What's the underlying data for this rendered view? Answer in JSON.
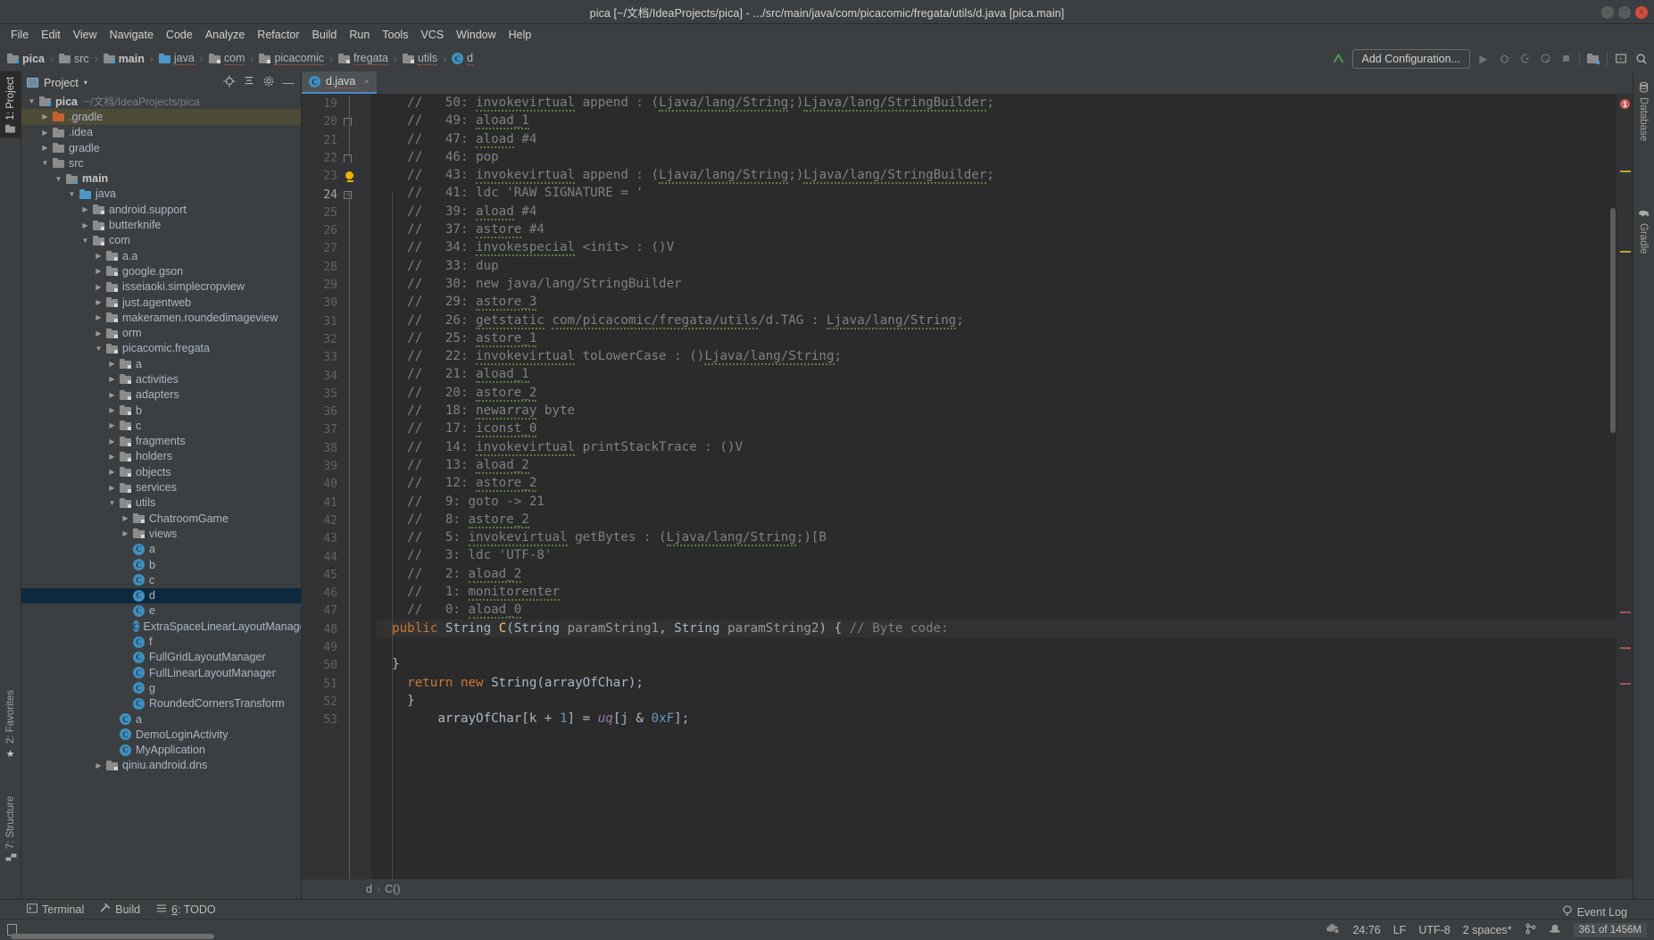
{
  "window": {
    "title": "pica [~/文档/IdeaProjects/pica] - .../src/main/java/com/picacomic/fregata/utils/d.java [pica.main]",
    "minimize": "–",
    "maximize": "□",
    "close": "×"
  },
  "menu": [
    "File",
    "Edit",
    "View",
    "Navigate",
    "Code",
    "Analyze",
    "Refactor",
    "Build",
    "Run",
    "Tools",
    "VCS",
    "Window",
    "Help"
  ],
  "breadcrumbs": [
    {
      "label": "pica",
      "icon": "source-root-folder-icon",
      "kind": "src",
      "bold": true,
      "spell": false
    },
    {
      "label": "src",
      "icon": "folder-icon",
      "kind": "grey",
      "bold": false,
      "spell": false
    },
    {
      "label": "main",
      "icon": "source-root-folder-icon",
      "kind": "src",
      "bold": true,
      "spell": false
    },
    {
      "label": "java",
      "icon": "folder-blue-icon",
      "kind": "blue",
      "bold": false,
      "spell": true
    },
    {
      "label": "com",
      "icon": "package-icon",
      "kind": "pkg",
      "bold": false,
      "spell": true
    },
    {
      "label": "picacomic",
      "icon": "package-icon",
      "kind": "pkg",
      "bold": false,
      "spell": true
    },
    {
      "label": "fregata",
      "icon": "package-icon",
      "kind": "pkg",
      "bold": false,
      "spell": true
    },
    {
      "label": "utils",
      "icon": "package-icon",
      "kind": "pkg",
      "bold": false,
      "spell": true
    },
    {
      "label": "d",
      "icon": "class-icon",
      "kind": "cls",
      "bold": false,
      "spell": true
    }
  ],
  "toolbar": {
    "add_configuration": "Add Configuration...",
    "icons": [
      "vcs-update-icon",
      "run-icon",
      "debug-icon",
      "run-coverage-icon",
      "profile-icon",
      "stop-icon",
      "project-structure-icon",
      "device-manager-icon",
      "search-everywhere-icon"
    ]
  },
  "left_tool_tabs": [
    {
      "label": "1: Project",
      "mnemonic": "1",
      "icon": "project-icon",
      "active": true
    },
    {
      "label": "2: Favorites",
      "mnemonic": "2",
      "icon": "star-icon",
      "active": false
    },
    {
      "label": "7: Structure",
      "mnemonic": "7",
      "icon": "structure-icon",
      "active": false
    }
  ],
  "right_tool_tabs": [
    {
      "label": "Database",
      "icon": "database-icon"
    },
    {
      "label": "Gradle",
      "icon": "gradle-elephant-icon"
    }
  ],
  "project_panel": {
    "title": "Project",
    "caret": "▾",
    "actions": [
      "locate-target-icon",
      "collapse-all-icon",
      "settings-icon",
      "hide-icon"
    ],
    "tree": [
      {
        "indent": 0,
        "arrow": "▼",
        "icon": "module-icon",
        "label": "pica",
        "bold": true,
        "sub": "~/文档/IdeaProjects/pica",
        "state": "none"
      },
      {
        "indent": 1,
        "arrow": "▶",
        "icon": "folder-orange-icon",
        "label": ".gradle",
        "bold": false,
        "sub": "",
        "state": "hover"
      },
      {
        "indent": 1,
        "arrow": "▶",
        "icon": "folder-icon",
        "label": ".idea",
        "bold": false,
        "sub": "",
        "state": "none"
      },
      {
        "indent": 1,
        "arrow": "▶",
        "icon": "folder-icon",
        "label": "gradle",
        "bold": false,
        "sub": "",
        "state": "none"
      },
      {
        "indent": 1,
        "arrow": "▼",
        "icon": "folder-icon",
        "label": "src",
        "bold": false,
        "sub": "",
        "state": "none"
      },
      {
        "indent": 2,
        "arrow": "▼",
        "icon": "module-icon",
        "label": "main",
        "bold": true,
        "sub": "",
        "state": "none"
      },
      {
        "indent": 3,
        "arrow": "▼",
        "icon": "folder-blue-icon",
        "label": "java",
        "bold": false,
        "sub": "",
        "state": "none"
      },
      {
        "indent": 4,
        "arrow": "▶",
        "icon": "package-icon",
        "label": "android.support",
        "bold": false,
        "sub": "",
        "state": "none"
      },
      {
        "indent": 4,
        "arrow": "▶",
        "icon": "package-icon",
        "label": "butterknife",
        "bold": false,
        "sub": "",
        "state": "none"
      },
      {
        "indent": 4,
        "arrow": "▼",
        "icon": "package-icon",
        "label": "com",
        "bold": false,
        "sub": "",
        "state": "none"
      },
      {
        "indent": 5,
        "arrow": "▶",
        "icon": "package-icon",
        "label": "a.a",
        "bold": false,
        "sub": "",
        "state": "none"
      },
      {
        "indent": 5,
        "arrow": "▶",
        "icon": "package-icon",
        "label": "google.gson",
        "bold": false,
        "sub": "",
        "state": "none"
      },
      {
        "indent": 5,
        "arrow": "▶",
        "icon": "package-icon",
        "label": "isseiaoki.simplecropview",
        "bold": false,
        "sub": "",
        "state": "none"
      },
      {
        "indent": 5,
        "arrow": "▶",
        "icon": "package-icon",
        "label": "just.agentweb",
        "bold": false,
        "sub": "",
        "state": "none"
      },
      {
        "indent": 5,
        "arrow": "▶",
        "icon": "package-icon",
        "label": "makeramen.roundedimageview",
        "bold": false,
        "sub": "",
        "state": "none"
      },
      {
        "indent": 5,
        "arrow": "▶",
        "icon": "package-icon",
        "label": "orm",
        "bold": false,
        "sub": "",
        "state": "none"
      },
      {
        "indent": 5,
        "arrow": "▼",
        "icon": "package-icon",
        "label": "picacomic.fregata",
        "bold": false,
        "sub": "",
        "state": "none"
      },
      {
        "indent": 6,
        "arrow": "▶",
        "icon": "package-icon",
        "label": "a",
        "bold": false,
        "sub": "",
        "state": "none"
      },
      {
        "indent": 6,
        "arrow": "▶",
        "icon": "package-icon",
        "label": "activities",
        "bold": false,
        "sub": "",
        "state": "none"
      },
      {
        "indent": 6,
        "arrow": "▶",
        "icon": "package-icon",
        "label": "adapters",
        "bold": false,
        "sub": "",
        "state": "none"
      },
      {
        "indent": 6,
        "arrow": "▶",
        "icon": "package-icon",
        "label": "b",
        "bold": false,
        "sub": "",
        "state": "none"
      },
      {
        "indent": 6,
        "arrow": "▶",
        "icon": "package-icon",
        "label": "c",
        "bold": false,
        "sub": "",
        "state": "none"
      },
      {
        "indent": 6,
        "arrow": "▶",
        "icon": "package-icon",
        "label": "fragments",
        "bold": false,
        "sub": "",
        "state": "none"
      },
      {
        "indent": 6,
        "arrow": "▶",
        "icon": "package-icon",
        "label": "holders",
        "bold": false,
        "sub": "",
        "state": "none"
      },
      {
        "indent": 6,
        "arrow": "▶",
        "icon": "package-icon",
        "label": "objects",
        "bold": false,
        "sub": "",
        "state": "none"
      },
      {
        "indent": 6,
        "arrow": "▶",
        "icon": "package-icon",
        "label": "services",
        "bold": false,
        "sub": "",
        "state": "none"
      },
      {
        "indent": 6,
        "arrow": "▼",
        "icon": "package-icon",
        "label": "utils",
        "bold": false,
        "sub": "",
        "state": "none"
      },
      {
        "indent": 7,
        "arrow": "▶",
        "icon": "package-icon",
        "label": "ChatroomGame",
        "bold": false,
        "sub": "",
        "state": "none"
      },
      {
        "indent": 7,
        "arrow": "▶",
        "icon": "package-icon",
        "label": "views",
        "bold": false,
        "sub": "",
        "state": "none"
      },
      {
        "indent": 7,
        "arrow": "",
        "icon": "class-icon",
        "label": "a",
        "bold": false,
        "sub": "",
        "state": "none"
      },
      {
        "indent": 7,
        "arrow": "",
        "icon": "class-icon",
        "label": "b",
        "bold": false,
        "sub": "",
        "state": "none"
      },
      {
        "indent": 7,
        "arrow": "",
        "icon": "class-icon",
        "label": "c",
        "bold": false,
        "sub": "",
        "state": "none"
      },
      {
        "indent": 7,
        "arrow": "",
        "icon": "class-icon",
        "label": "d",
        "bold": false,
        "sub": "",
        "state": "selected"
      },
      {
        "indent": 7,
        "arrow": "",
        "icon": "class-icon",
        "label": "e",
        "bold": false,
        "sub": "",
        "state": "none"
      },
      {
        "indent": 7,
        "arrow": "",
        "icon": "class-icon",
        "label": "ExtraSpaceLinearLayoutManager",
        "bold": false,
        "sub": "",
        "state": "none"
      },
      {
        "indent": 7,
        "arrow": "",
        "icon": "class-icon",
        "label": "f",
        "bold": false,
        "sub": "",
        "state": "none"
      },
      {
        "indent": 7,
        "arrow": "",
        "icon": "class-icon",
        "label": "FullGridLayoutManager",
        "bold": false,
        "sub": "",
        "state": "none"
      },
      {
        "indent": 7,
        "arrow": "",
        "icon": "class-icon",
        "label": "FullLinearLayoutManager",
        "bold": false,
        "sub": "",
        "state": "none"
      },
      {
        "indent": 7,
        "arrow": "",
        "icon": "class-icon",
        "label": "g",
        "bold": false,
        "sub": "",
        "state": "none"
      },
      {
        "indent": 7,
        "arrow": "",
        "icon": "class-icon",
        "label": "RoundedCornersTransform",
        "bold": false,
        "sub": "",
        "state": "none"
      },
      {
        "indent": 6,
        "arrow": "",
        "icon": "class-icon",
        "label": "a",
        "bold": false,
        "sub": "",
        "state": "none"
      },
      {
        "indent": 6,
        "arrow": "",
        "icon": "class-icon",
        "label": "DemoLoginActivity",
        "bold": false,
        "sub": "",
        "state": "none"
      },
      {
        "indent": 6,
        "arrow": "",
        "icon": "class-icon",
        "label": "MyApplication",
        "bold": false,
        "sub": "",
        "state": "none"
      },
      {
        "indent": 5,
        "arrow": "▶",
        "icon": "package-icon",
        "label": "qiniu.android.dns",
        "bold": false,
        "sub": "",
        "state": "none"
      }
    ]
  },
  "editor": {
    "tab": {
      "label": "d.java",
      "icon": "class-icon",
      "close": "×"
    },
    "first_line": 19,
    "current_line": 24,
    "bulb_line": 23,
    "lines": [
      {
        "n": 19,
        "fold": "",
        "text": "        arrayOfChar[k + 1] = uq[j & 0xF];"
      },
      {
        "n": 20,
        "fold": "cap",
        "text": "    }"
      },
      {
        "n": 21,
        "fold": "",
        "text": "    return new String(arrayOfChar);"
      },
      {
        "n": 22,
        "fold": "cap",
        "text": "  }"
      },
      {
        "n": 23,
        "fold": "",
        "text": ""
      },
      {
        "n": 24,
        "fold": "box",
        "text": "  public String C(String paramString1, String paramString2) { // Byte code:"
      },
      {
        "n": 25,
        "fold": "",
        "text": "    //   0: aload_0"
      },
      {
        "n": 26,
        "fold": "",
        "text": "    //   1: monitorenter"
      },
      {
        "n": 27,
        "fold": "",
        "text": "    //   2: aload_2"
      },
      {
        "n": 28,
        "fold": "",
        "text": "    //   3: ldc 'UTF-8'"
      },
      {
        "n": 29,
        "fold": "",
        "text": "    //   5: invokevirtual getBytes : (Ljava/lang/String;)[B"
      },
      {
        "n": 30,
        "fold": "",
        "text": "    //   8: astore_2"
      },
      {
        "n": 31,
        "fold": "",
        "text": "    //   9: goto -> 21"
      },
      {
        "n": 32,
        "fold": "",
        "text": "    //   12: astore_2"
      },
      {
        "n": 33,
        "fold": "",
        "text": "    //   13: aload_2"
      },
      {
        "n": 34,
        "fold": "",
        "text": "    //   14: invokevirtual printStackTrace : ()V"
      },
      {
        "n": 35,
        "fold": "",
        "text": "    //   17: iconst_0"
      },
      {
        "n": 36,
        "fold": "",
        "text": "    //   18: newarray byte"
      },
      {
        "n": 37,
        "fold": "",
        "text": "    //   20: astore_2"
      },
      {
        "n": 38,
        "fold": "",
        "text": "    //   21: aload_1"
      },
      {
        "n": 39,
        "fold": "",
        "text": "    //   22: invokevirtual toLowerCase : ()Ljava/lang/String;"
      },
      {
        "n": 40,
        "fold": "",
        "text": "    //   25: astore_1"
      },
      {
        "n": 41,
        "fold": "",
        "text": "    //   26: getstatic com/picacomic/fregata/utils/d.TAG : Ljava/lang/String;"
      },
      {
        "n": 42,
        "fold": "",
        "text": "    //   29: astore_3"
      },
      {
        "n": 43,
        "fold": "",
        "text": "    //   30: new java/lang/StringBuilder"
      },
      {
        "n": 44,
        "fold": "",
        "text": "    //   33: dup"
      },
      {
        "n": 45,
        "fold": "",
        "text": "    //   34: invokespecial <init> : ()V"
      },
      {
        "n": 46,
        "fold": "",
        "text": "    //   37: astore #4"
      },
      {
        "n": 47,
        "fold": "",
        "text": "    //   39: aload #4"
      },
      {
        "n": 48,
        "fold": "",
        "text": "    //   41: ldc 'RAW SIGNATURE = '"
      },
      {
        "n": 49,
        "fold": "",
        "text": "    //   43: invokevirtual append : (Ljava/lang/String;)Ljava/lang/StringBuilder;"
      },
      {
        "n": 50,
        "fold": "",
        "text": "    //   46: pop"
      },
      {
        "n": 51,
        "fold": "",
        "text": "    //   47: aload #4"
      },
      {
        "n": 52,
        "fold": "",
        "text": "    //   49: aload_1"
      },
      {
        "n": 53,
        "fold": "",
        "text": "    //   50: invokevirtual append : (Ljava/lang/String;)Ljava/lang/StringBuilder;"
      }
    ],
    "crumb": {
      "class": "d",
      "sep": "›",
      "method": "C()"
    }
  },
  "markers": {
    "error_count": "1"
  },
  "bottom_tabs": [
    {
      "label": "Terminal",
      "mnemonic": "",
      "icon": "terminal-icon"
    },
    {
      "label": "Build",
      "mnemonic": "",
      "icon": "build-hammer-icon"
    },
    {
      "label": "6: TODO",
      "mnemonic": "6",
      "icon": "todo-list-icon"
    }
  ],
  "event_log": {
    "label": "Event Log",
    "icon": "balloon-icon"
  },
  "status": {
    "caret": "24:76",
    "line_separator": "LF",
    "encoding": "UTF-8",
    "indent": "2 spaces*",
    "memory": "361 of 1456M",
    "icons": [
      "git-branch-icon",
      "inspection-hat-icon",
      "cloud-icon"
    ]
  }
}
